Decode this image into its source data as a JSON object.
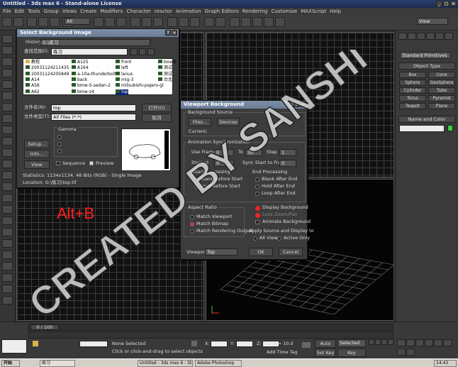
{
  "app": {
    "title": "Untitled - 3ds max 6 - Stand-alone License"
  },
  "menu": [
    "File",
    "Edit",
    "Tools",
    "Group",
    "Views",
    "Create",
    "Modifiers",
    "Character",
    "reactor",
    "Animation",
    "Graph Editors",
    "Rendering",
    "Customize",
    "MAXScript",
    "Help"
  ],
  "toolbar": {
    "filter": "All",
    "view": "View"
  },
  "command_panel": {
    "dropdown": "Standard Primitives",
    "object_type_label": "Object Type",
    "buttons": [
      "Box",
      "Cone",
      "Sphere",
      "GeoSphere",
      "Cylinder",
      "Tube",
      "Torus",
      "Pyramid",
      "Teapot",
      "Plane"
    ],
    "name_color_label": "Name and Color"
  },
  "select_bg_dialog": {
    "title": "Select Background Image",
    "history_label": "History:",
    "history_value": "G:\\练习",
    "lookin_label": "查找范围(I):",
    "lookin_value": "练习",
    "files_col1": [
      "教程",
      "20031124211435",
      "20031124205849",
      "A14",
      "A58",
      "A62"
    ],
    "files_col2": [
      "A125",
      "A164",
      "a-10a-thunderbolt-4",
      "back",
      "bmw-5-sedan-2",
      "bmw-z4"
    ],
    "files_col3": [
      "front",
      "left",
      "lanus",
      "mig-3",
      "mitsubishi-pajero-gl",
      "top"
    ],
    "files_col4": [
      "board",
      "测试",
      "测试",
      "台北",
      "",
      ""
    ],
    "filename_label": "文件名(N):",
    "filename_value": "top",
    "filetype_label": "文件类型(T):",
    "filetype_value": "All Files (*.*)",
    "open_button": "打开(O)",
    "cancel_button": "取消",
    "gamma_label": "Gamma",
    "setup_button": "Setup...",
    "info_button": "Info...",
    "view_button": "View",
    "sequence_label": "Sequence",
    "preview_label": "Preview",
    "statistics": "Statistics:  1134x1134, 48 Bits (RGB) - Single Image",
    "location": "Location:  G:\\练习\\top.tif"
  },
  "viewport_bg_dialog": {
    "title": "Viewport Background",
    "bg_source_label": "Background Source",
    "files_button": "Files...",
    "devices_button": "Devices",
    "current_label": "Current:",
    "anim_sync_label": "Animation Synchronization",
    "use_frame_label": "Use Frame",
    "use_frame_value": "0",
    "to_label": "To",
    "to_value": "30",
    "step_label": "Step",
    "step_value": "1",
    "start_at_label": "Start at",
    "start_at_value": "0",
    "sync_label": "Sync Start to Frame",
    "sync_value": "0",
    "start_proc_label": "Start Processing",
    "blank_before_label": "Blank Before Start",
    "hold_before_label": "Hold Before Start",
    "end_proc_label": "End Processing",
    "blank_after_label": "Blank After End",
    "hold_after_label": "Hold After End",
    "loop_after_label": "Loop After End",
    "aspect_label": "Aspect Ratio",
    "match_viewport_label": "Match Viewport",
    "match_bitmap_label": "Match Bitmap",
    "match_render_label": "Match Rendering Output",
    "display_bg_label": "Display Background",
    "lock_zoom_label": "Lock Zoom/Pan",
    "animate_bg_label": "Animate Background",
    "apply_label": "Apply Source and Display to",
    "all_views_label": "All Views",
    "active_only_label": "Active Only",
    "viewport_label": "Viewport:",
    "viewport_value": "Top",
    "ok_button": "OK",
    "cancel_button": "Cancel"
  },
  "overlay": {
    "shortcut": "Alt+B",
    "watermark": "CREATED BY SANSHI"
  },
  "timeline": {
    "frame": "0 / 100"
  },
  "status": {
    "selection": "None Selected",
    "prompt": "Click or click-and-drag to select objects",
    "x_label": "X:",
    "y_label": "Y:",
    "z_label": "Z:",
    "grid": "Grid = 10.0",
    "auto_key": "Auto Key",
    "selected": "Selected",
    "set_key": "Set Key",
    "key_filters": "Key Filters...",
    "add_time_tag": "Add Time Tag"
  },
  "taskbar": {
    "start": "开始",
    "items": [
      "练习",
      "Untitled - 3ds max 6 - St...",
      "Adobe Photoshop"
    ],
    "clock": "14:43"
  },
  "colors": {
    "accent_red": "#ff2020",
    "title_blue": "#2a3f6e",
    "swatch_green": "#3cd03c"
  }
}
